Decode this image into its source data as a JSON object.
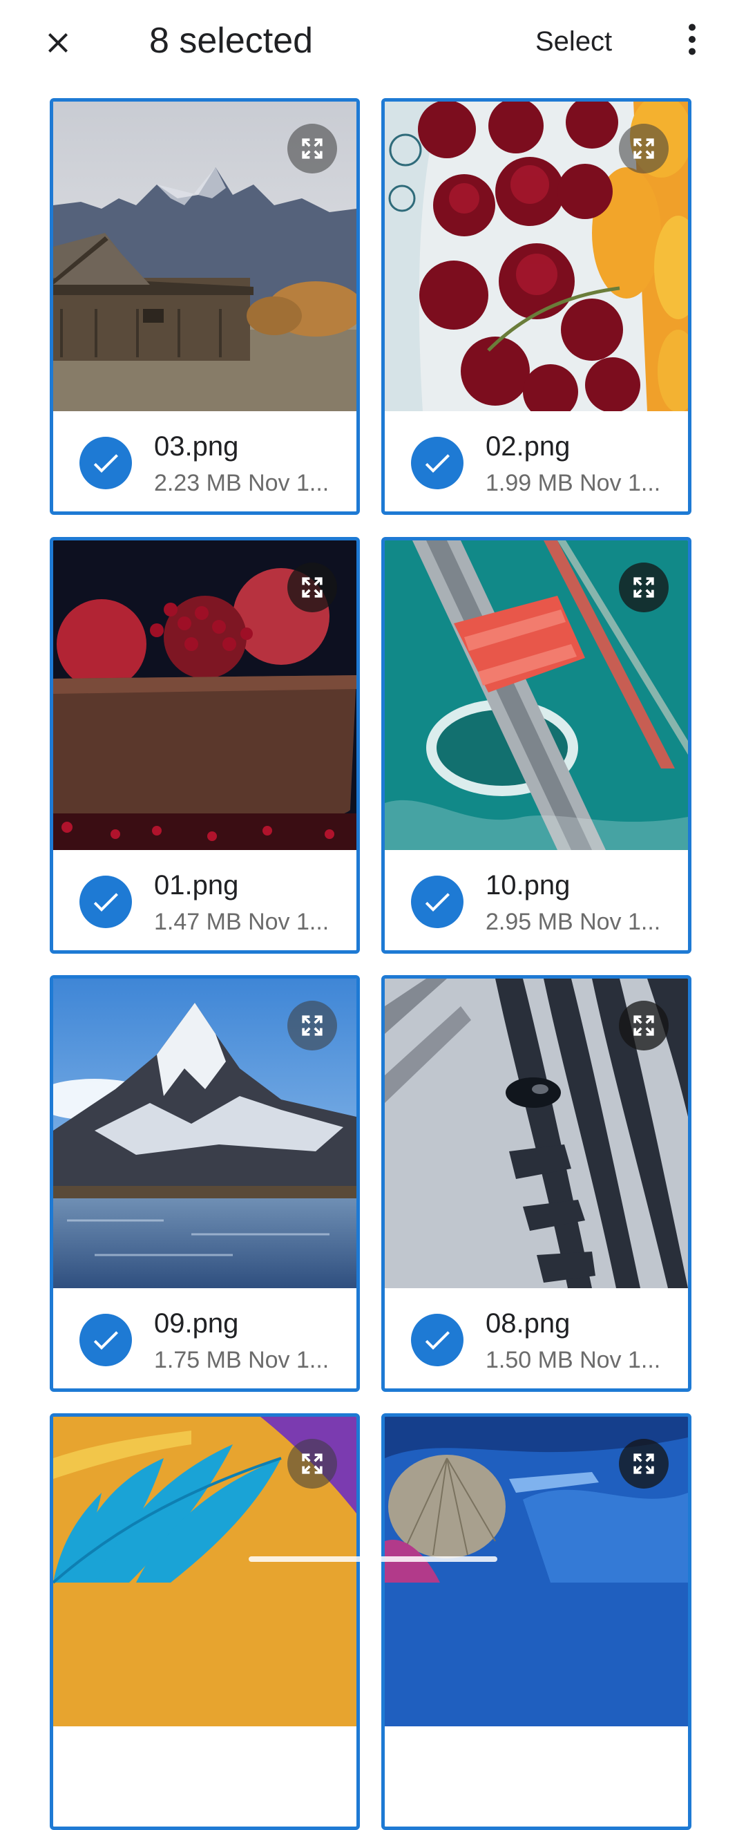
{
  "header": {
    "title": "8 selected",
    "select_label": "Select"
  },
  "colors": {
    "accent": "#1e7ad4",
    "meta_text": "#6b6b6b"
  },
  "icons": [
    "close-icon",
    "more-vert-icon",
    "expand-icon",
    "check-icon"
  ],
  "files": [
    {
      "name": "03.png",
      "meta": "2.23 MB Nov 1...",
      "selected": true
    },
    {
      "name": "02.png",
      "meta": "1.99 MB Nov 1...",
      "selected": true
    },
    {
      "name": "01.png",
      "meta": "1.47 MB Nov 1...",
      "selected": true
    },
    {
      "name": "10.png",
      "meta": "2.95 MB Nov 1...",
      "selected": true
    },
    {
      "name": "09.png",
      "meta": "1.75 MB Nov 1...",
      "selected": true
    },
    {
      "name": "08.png",
      "meta": "1.50 MB Nov 1...",
      "selected": true
    },
    {
      "name": "",
      "meta": "",
      "selected": true
    },
    {
      "name": "",
      "meta": "",
      "selected": true
    }
  ]
}
